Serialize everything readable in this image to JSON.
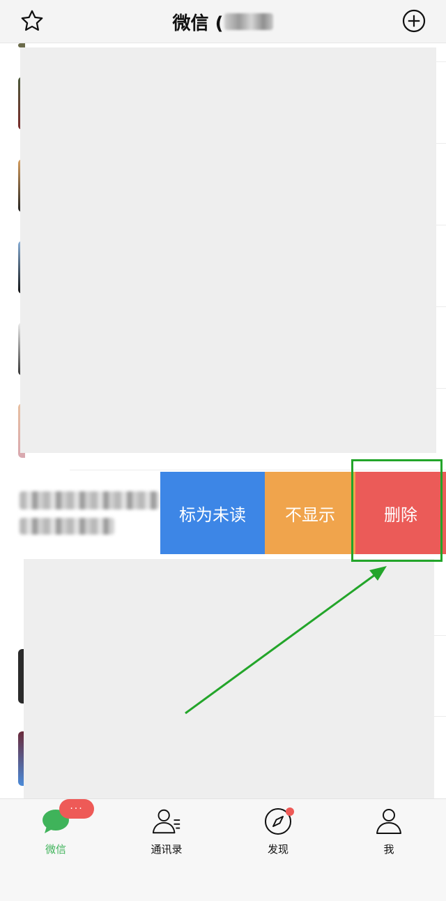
{
  "header": {
    "title": "微信 (",
    "title_suffix_redacted": true
  },
  "actions": {
    "mark_unread": "标为未读",
    "hide": "不显示",
    "delete": "删除"
  },
  "tabs": [
    {
      "label": "微信",
      "icon": "chat-bubble-icon",
      "active": true
    },
    {
      "label": "通讯录",
      "icon": "contacts-icon",
      "active": false
    },
    {
      "label": "发现",
      "icon": "compass-icon",
      "active": false
    },
    {
      "label": "我",
      "icon": "person-icon",
      "active": false
    }
  ],
  "badge": {
    "text": "···"
  },
  "colors": {
    "accent_green": "#3fb35a",
    "mark_unread_blue": "#3d86e6",
    "hide_orange": "#f0a44c",
    "delete_red": "#eb5b58",
    "annotation_green": "#23a52a",
    "badge_red": "#ee5a57"
  }
}
